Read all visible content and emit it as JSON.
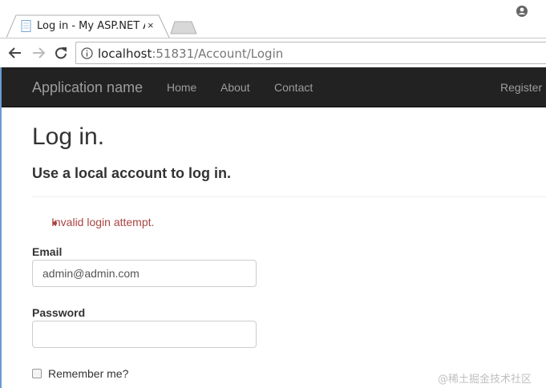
{
  "browser": {
    "tab_title": "Log in - My ASP.NET A",
    "tab_close": "×",
    "url_host": "localhost",
    "url_path": ":51831/Account/Login"
  },
  "navbar": {
    "brand": "Application name",
    "links": [
      "Home",
      "About",
      "Contact"
    ],
    "register": "Register"
  },
  "page": {
    "title": "Log in.",
    "subtitle": "Use a local account to log in.",
    "error": "Invalid login attempt.",
    "email_label": "Email",
    "email_value": "admin@admin.com",
    "password_label": "Password",
    "password_value": "",
    "remember_label": "Remember me?"
  },
  "watermark": "@稀土掘金技术社区",
  "colors": {
    "navbar_bg": "#222222",
    "navbar_text": "#9d9d9d",
    "error": "#a94442",
    "window_border": "#6b9bd2"
  }
}
